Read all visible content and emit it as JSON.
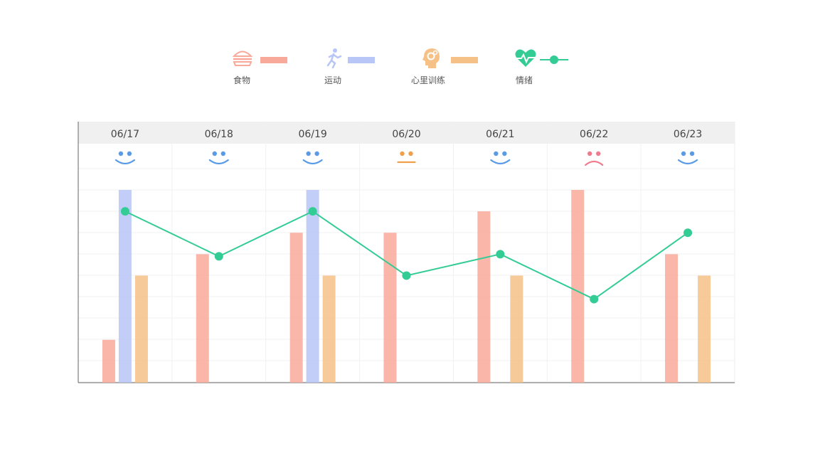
{
  "legend": [
    {
      "label": "食物",
      "icon": "burger-icon",
      "color": "#f9a99a",
      "kind": "bar"
    },
    {
      "label": "运动",
      "icon": "running-person-icon",
      "color": "#b8c6f7",
      "kind": "bar"
    },
    {
      "label": "心里训练",
      "icon": "head-gears-icon",
      "color": "#f6c187",
      "kind": "bar"
    },
    {
      "label": "情绪",
      "icon": "heartbeat-icon",
      "color": "#34cc95",
      "kind": "line"
    }
  ],
  "chart_data": {
    "type": "bar",
    "categories": [
      "06/17",
      "06/18",
      "06/19",
      "06/20",
      "06/21",
      "06/22",
      "06/23"
    ],
    "moods": [
      "happy",
      "happy",
      "happy",
      "neutral",
      "happy",
      "sad",
      "happy"
    ],
    "mood_colors": {
      "happy": "#5b9be6",
      "neutral": "#f0a04a",
      "sad": "#f07a8e"
    },
    "series": [
      {
        "name": "食物",
        "type": "bar",
        "color": "#f9a99a",
        "values": [
          2,
          6,
          7,
          7,
          8,
          9,
          6
        ]
      },
      {
        "name": "运动",
        "type": "bar",
        "color": "#b8c6f7",
        "values": [
          9,
          0,
          9,
          0,
          0,
          0,
          0
        ]
      },
      {
        "name": "心里训练",
        "type": "bar",
        "color": "#f6c187",
        "values": [
          5,
          0,
          5,
          0,
          5,
          0,
          5
        ]
      },
      {
        "name": "情绪",
        "type": "line",
        "color": "#34cc95",
        "values": [
          8,
          5.9,
          8,
          5,
          6,
          3.9,
          7
        ]
      }
    ],
    "ylim": [
      0,
      9
    ],
    "grid": true,
    "legend_position": "top-center",
    "header_background": "#f0f0f0"
  }
}
